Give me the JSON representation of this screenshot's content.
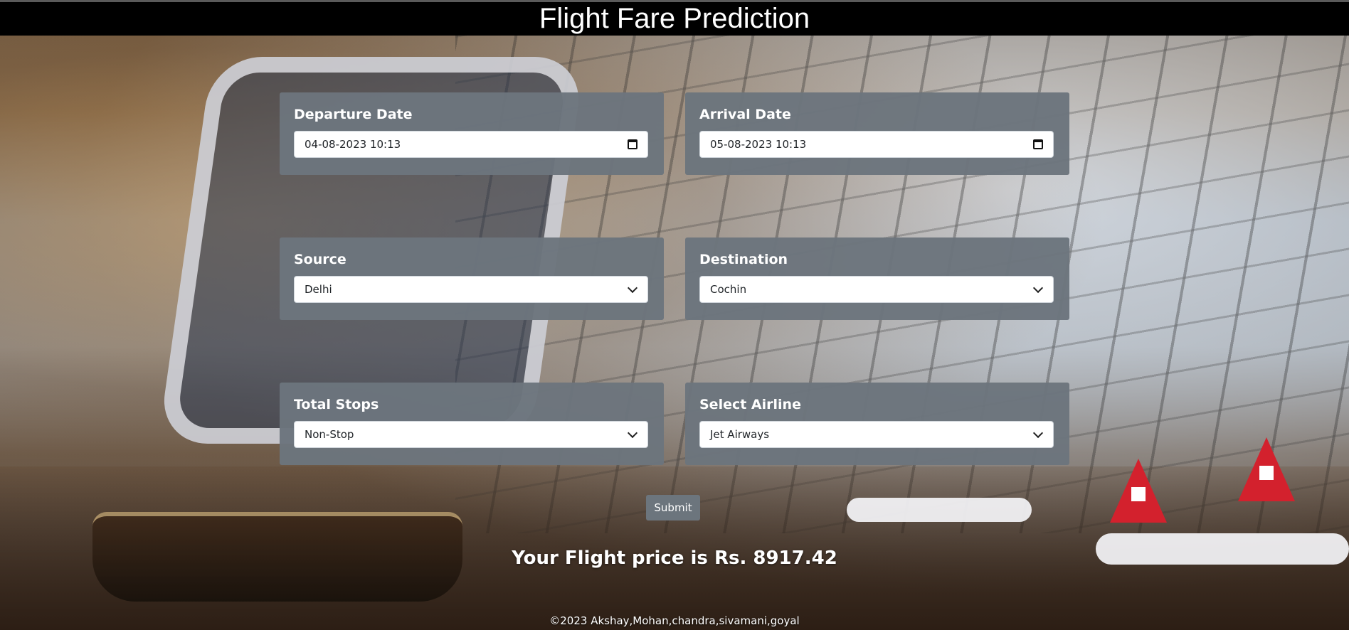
{
  "header": {
    "title": "Flight Fare Prediction"
  },
  "form": {
    "departure": {
      "label": "Departure Date",
      "value": "04-08-2023 10:13",
      "icon": "calendar-icon"
    },
    "arrival": {
      "label": "Arrival Date",
      "value": "05-08-2023 10:13",
      "icon": "calendar-icon"
    },
    "source": {
      "label": "Source",
      "selected": "Delhi",
      "icon": "chevron-down-icon"
    },
    "destination": {
      "label": "Destination",
      "selected": "Cochin",
      "icon": "chevron-down-icon"
    },
    "stops": {
      "label": "Total Stops",
      "selected": "Non-Stop",
      "icon": "chevron-down-icon"
    },
    "airline": {
      "label": "Select Airline",
      "selected": "Jet Airways",
      "icon": "chevron-down-icon"
    },
    "submit_label": "Submit"
  },
  "result": {
    "text": "Your Flight price is Rs. 8917.42"
  },
  "footer": {
    "text": "©2023 Akshay,Mohan,chandra,sivamani,goyal"
  },
  "colors": {
    "header_bg": "#000000",
    "panel_bg": "#6c757d",
    "button_bg": "#6c757d",
    "text_light": "#ffffff"
  }
}
